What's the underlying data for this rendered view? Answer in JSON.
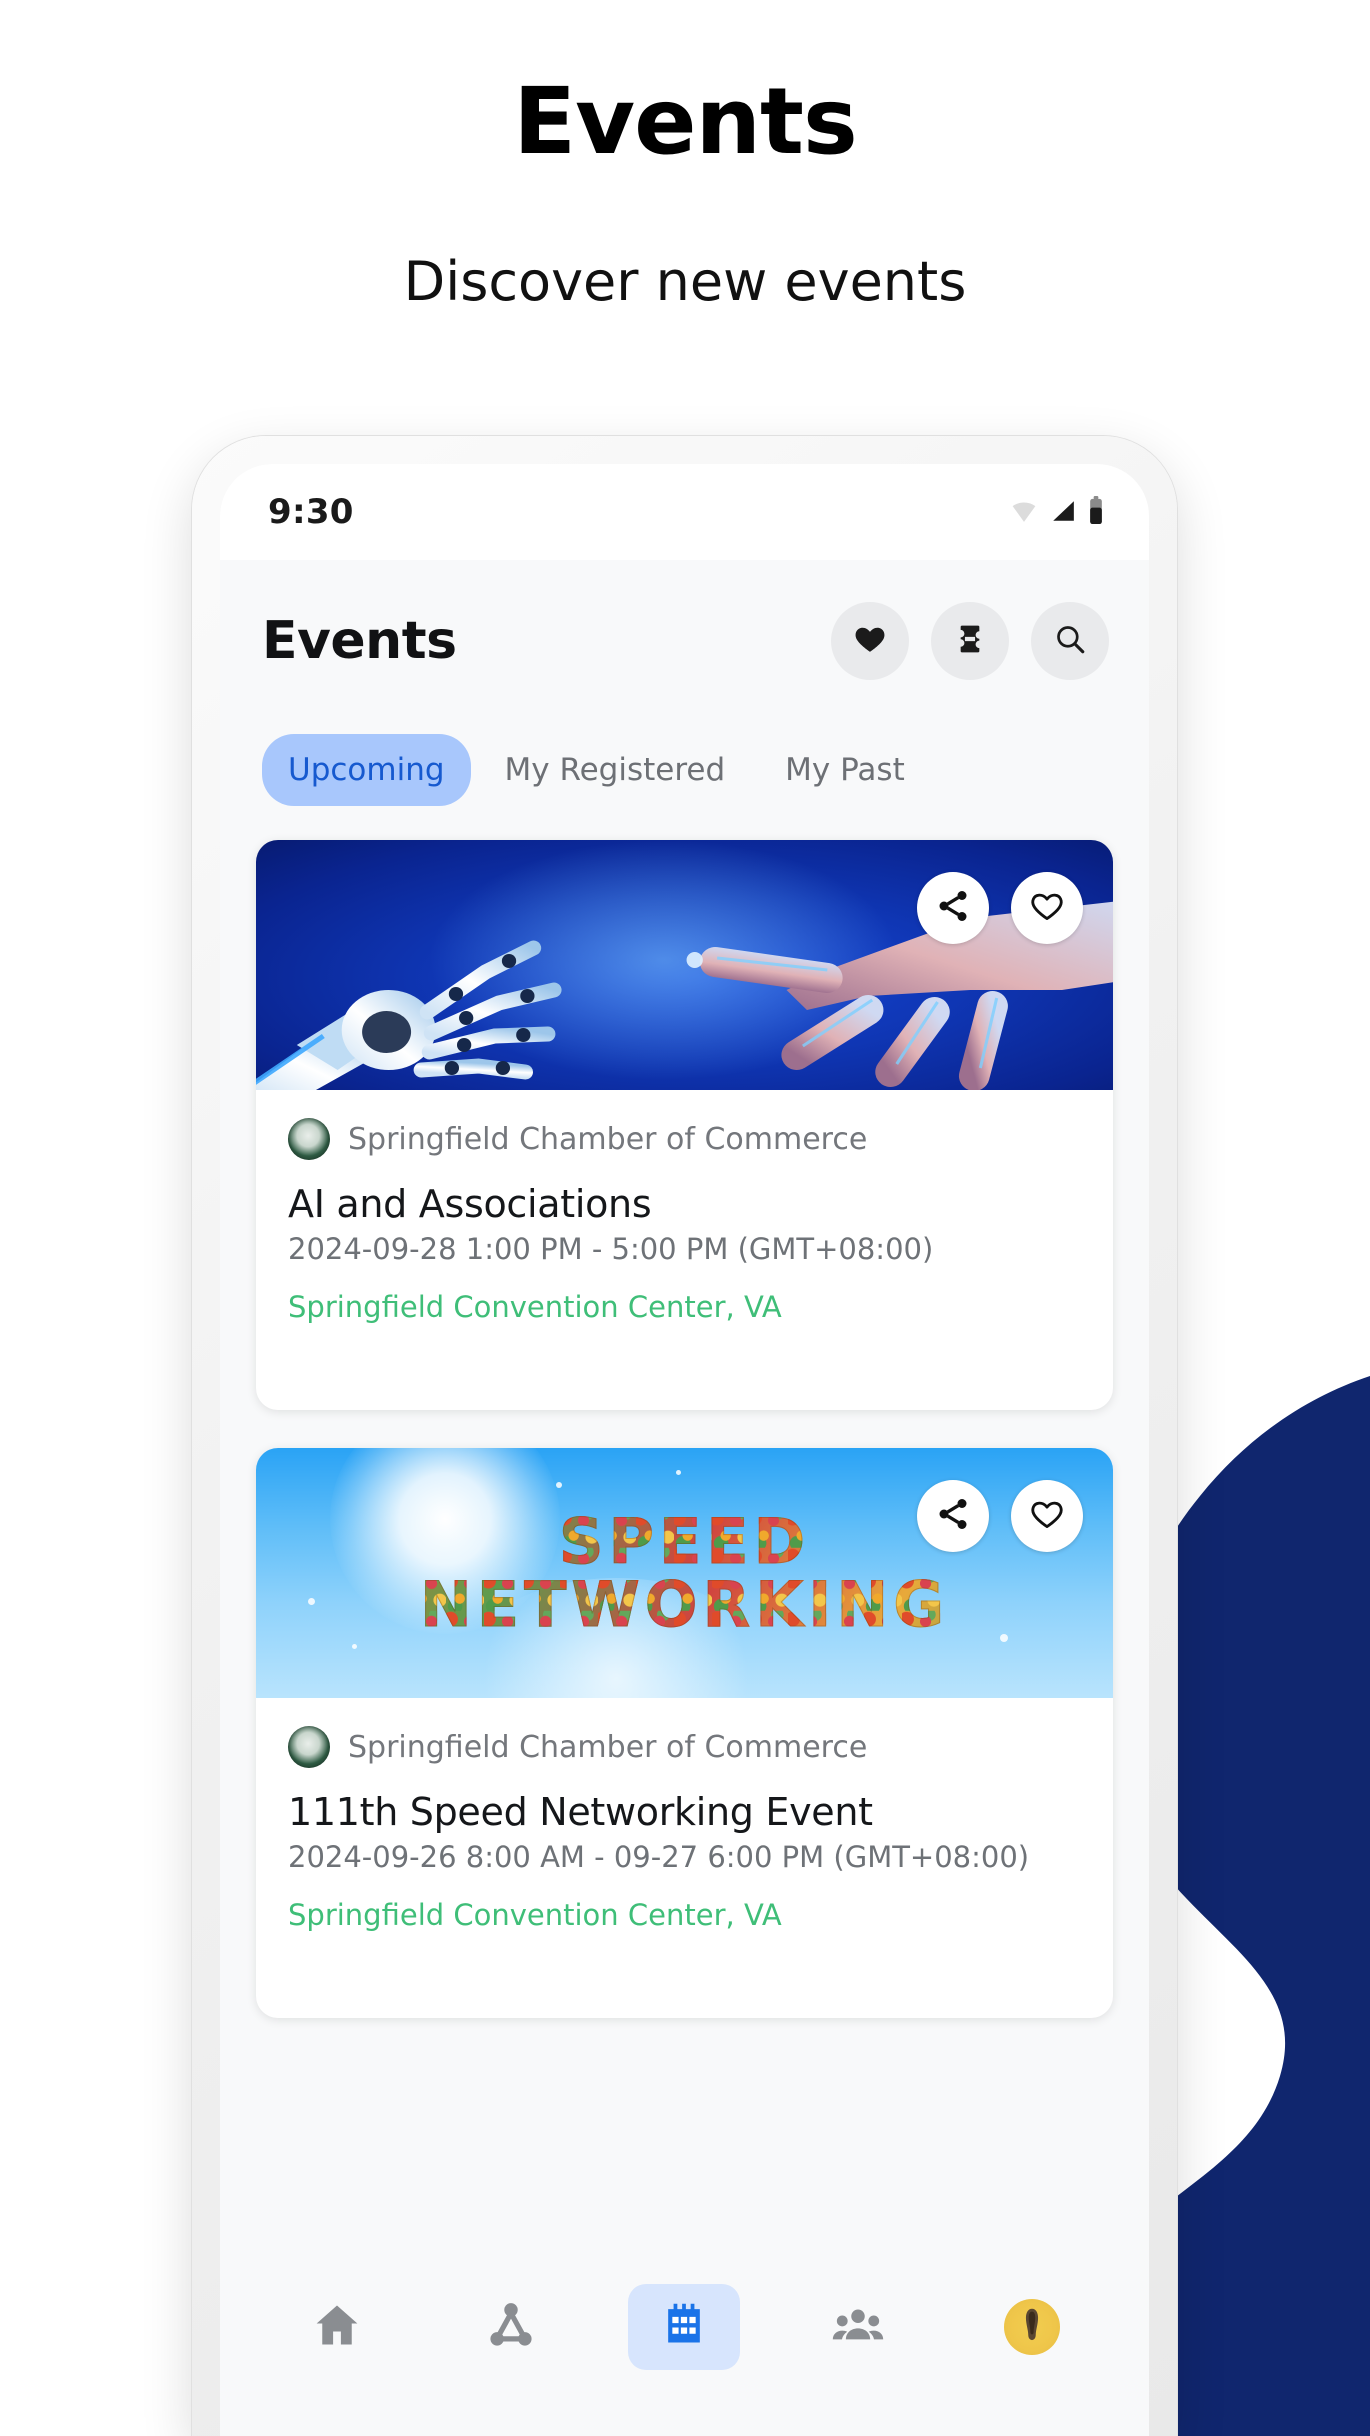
{
  "promo": {
    "title": "Events",
    "subtitle": "Discover new events"
  },
  "colors": {
    "accent_blue": "#1659cf",
    "tab_pill": "#a8c7fc",
    "venue_green": "#3fbe78",
    "nav_active_bg": "#d7e5fd",
    "nav_active_icon": "#1a73e8",
    "blob_navy": "#10266e",
    "avatar_yellow": "#f2cd4f"
  },
  "status_bar": {
    "time": "9:30",
    "icons": [
      "wifi-icon",
      "cellular-signal-icon",
      "battery-icon"
    ]
  },
  "app_header": {
    "title": "Events",
    "actions": [
      {
        "name": "favorites-button",
        "icon": "heart-filled-icon"
      },
      {
        "name": "tickets-button",
        "icon": "ticket-icon"
      },
      {
        "name": "search-button",
        "icon": "search-icon"
      }
    ]
  },
  "tabs": [
    {
      "label": "Upcoming",
      "active": true
    },
    {
      "label": "My Registered",
      "active": false
    },
    {
      "label": "My Past",
      "active": false
    }
  ],
  "event_cards": [
    {
      "hero": "ai-robot-human-hands-image",
      "organizer": "Springfield Chamber of Commerce",
      "title": "AI and Associations",
      "datetime": "2024-09-28 1:00 PM - 5:00 PM (GMT+08:00)",
      "venue": "Springfield Convention Center, VA",
      "share_icon": "share-icon",
      "favorite_icon": "heart-outline-icon"
    },
    {
      "hero": "speed-networking-sky-image",
      "hero_text_line1": "SPEED",
      "hero_text_line2": "NETWORKING",
      "organizer": "Springfield Chamber of Commerce",
      "title": "111th Speed Networking Event",
      "datetime": "2024-09-26 8:00 AM - 09-27 6:00 PM (GMT+08:00)",
      "venue": "Springfield Convention Center, VA",
      "share_icon": "share-icon",
      "favorite_icon": "heart-outline-icon"
    }
  ],
  "bottom_nav": [
    {
      "name": "nav-home",
      "icon": "home-icon",
      "active": false
    },
    {
      "name": "nav-connections",
      "icon": "network-nodes-icon",
      "active": false
    },
    {
      "name": "nav-events",
      "icon": "calendar-icon",
      "active": true
    },
    {
      "name": "nav-groups",
      "icon": "people-group-icon",
      "active": false
    },
    {
      "name": "nav-profile",
      "icon": "avatar-icon",
      "active": false
    }
  ]
}
